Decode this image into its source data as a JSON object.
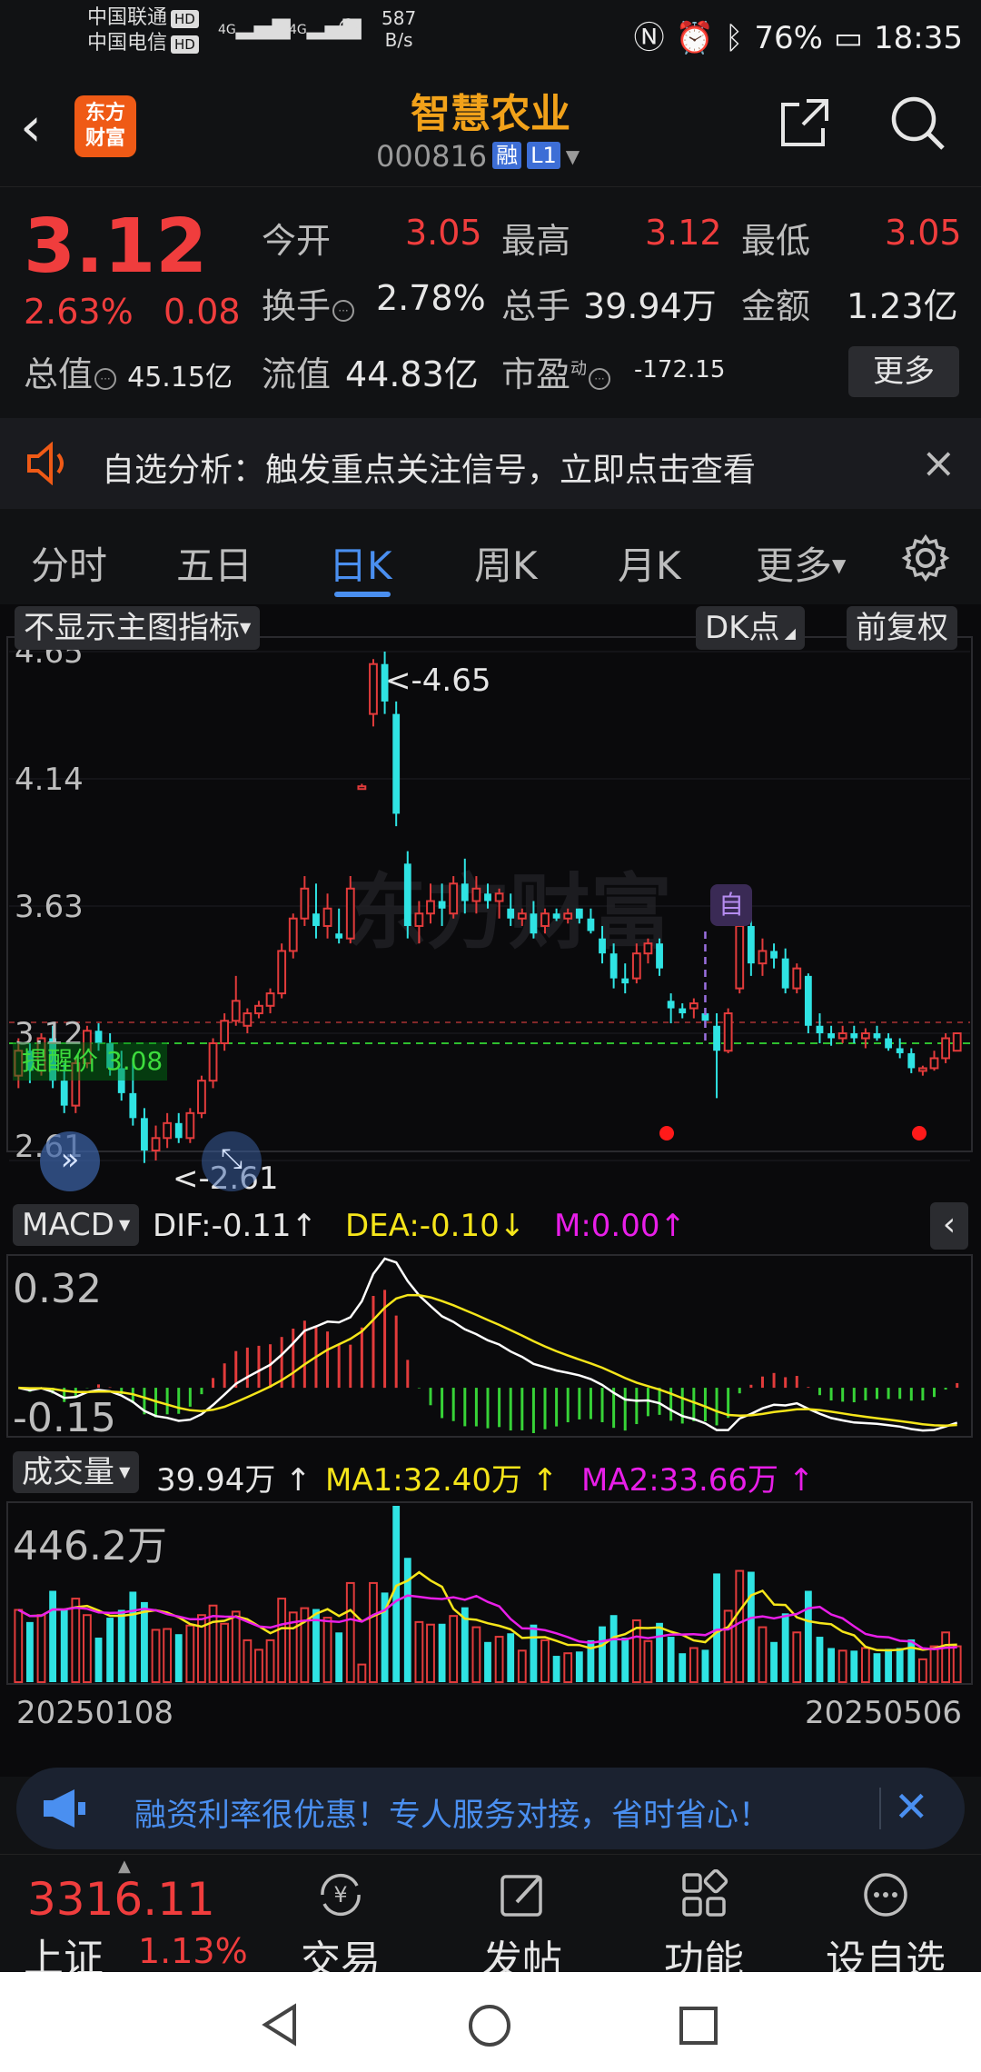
{
  "status_bar": {
    "carrier1": "中国联通",
    "carrier2": "中国电信",
    "hd": "HD",
    "net1": "4G",
    "net2": "4G",
    "speed": "587",
    "speed_unit": "B/s",
    "battery": "76%",
    "time": "18:35"
  },
  "header": {
    "logo_line1": "东方",
    "logo_line2": "财富",
    "title": "智慧农业",
    "code": "000816",
    "badge_rong": "融",
    "badge_level": "L1"
  },
  "quote": {
    "price": "3.12",
    "pct": "2.63%",
    "change": "0.08",
    "total_label": "总值",
    "total_value": "45.15亿",
    "open_label": "今开",
    "open_value": "3.05",
    "high_label": "最高",
    "high_value": "3.12",
    "low_label": "最低",
    "low_value": "3.05",
    "turnover_label": "换手",
    "turnover_value": "2.78%",
    "volume_label": "总手",
    "volume_value": "39.94万",
    "amount_label": "金额",
    "amount_value": "1.23亿",
    "float_label": "流值",
    "float_value": "44.83亿",
    "pe_label": "市盈",
    "pe_sup": "动",
    "pe_value": "-172.15",
    "more": "更多"
  },
  "notice": {
    "text": "自选分析：触发重点关注信号，立即点击查看"
  },
  "tabs": [
    "分时",
    "五日",
    "日K",
    "周K",
    "月K",
    "更多"
  ],
  "active_tab": "日K",
  "chart_controls": {
    "indicator_select": "不显示主图指标",
    "dk_point": "DK点",
    "adjust": "前复权",
    "alert_label": "提醒价 3.08",
    "high_mark": "<-4.65",
    "low_mark": "<-2.61",
    "self_mark": "自",
    "watermark": "东方财富"
  },
  "macd": {
    "label": "MACD",
    "dif": "DIF:-0.11",
    "dea": "DEA:-0.10",
    "m": "M:0.00",
    "top_value": "0.32",
    "bottom_value": "-0.15"
  },
  "volume": {
    "label": "成交量",
    "value": "39.94万",
    "ma1": "MA1:32.40万",
    "ma2": "MA2:33.66万",
    "top_value": "446.2万",
    "start_date": "20250108",
    "end_date": "20250506"
  },
  "chart_data": {
    "type": "candlestick",
    "y_ticks": [
      "4.65",
      "4.14",
      "3.63",
      "3.12",
      "2.61"
    ],
    "y_range": [
      2.61,
      4.65
    ],
    "alert_price": 3.08,
    "x_range": [
      "20250108",
      "20250506"
    ],
    "candles": [
      [
        2.95,
        3.1,
        2.9,
        3.05
      ],
      [
        3.05,
        3.08,
        2.92,
        2.97
      ],
      [
        2.97,
        3.12,
        2.95,
        3.1
      ],
      [
        3.1,
        3.15,
        2.9,
        2.93
      ],
      [
        2.93,
        3.0,
        2.8,
        2.83
      ],
      [
        2.83,
        3.02,
        2.8,
        3.0
      ],
      [
        3.0,
        3.15,
        2.98,
        3.13
      ],
      [
        3.13,
        3.16,
        3.05,
        3.08
      ],
      [
        3.08,
        3.12,
        2.95,
        2.98
      ],
      [
        2.98,
        3.05,
        2.85,
        2.88
      ],
      [
        2.88,
        3.02,
        2.75,
        2.78
      ],
      [
        2.78,
        2.82,
        2.6,
        2.65
      ],
      [
        2.65,
        2.75,
        2.61,
        2.7
      ],
      [
        2.7,
        2.8,
        2.66,
        2.76
      ],
      [
        2.76,
        2.8,
        2.68,
        2.7
      ],
      [
        2.7,
        2.82,
        2.68,
        2.8
      ],
      [
        2.8,
        2.95,
        2.78,
        2.93
      ],
      [
        2.93,
        3.1,
        2.9,
        3.08
      ],
      [
        3.08,
        3.2,
        3.05,
        3.17
      ],
      [
        3.17,
        3.35,
        3.15,
        3.25
      ],
      [
        3.15,
        3.22,
        3.12,
        3.2
      ],
      [
        3.2,
        3.25,
        3.18,
        3.23
      ],
      [
        3.23,
        3.3,
        3.2,
        3.28
      ],
      [
        3.28,
        3.48,
        3.26,
        3.45
      ],
      [
        3.45,
        3.6,
        3.42,
        3.58
      ],
      [
        3.58,
        3.75,
        3.55,
        3.7
      ],
      [
        3.6,
        3.72,
        3.5,
        3.55
      ],
      [
        3.55,
        3.68,
        3.5,
        3.62
      ],
      [
        3.52,
        3.62,
        3.48,
        3.5
      ],
      [
        3.5,
        3.75,
        3.48,
        3.7
      ],
      [
        4.1,
        4.12,
        4.1,
        4.11
      ],
      [
        4.4,
        4.62,
        4.35,
        4.6
      ],
      [
        4.6,
        4.65,
        4.4,
        4.45
      ],
      [
        4.4,
        4.45,
        3.95,
        4.0
      ],
      [
        3.8,
        3.85,
        3.5,
        3.55
      ],
      [
        3.55,
        3.65,
        3.48,
        3.6
      ],
      [
        3.6,
        3.72,
        3.56,
        3.65
      ],
      [
        3.65,
        3.72,
        3.55,
        3.62
      ],
      [
        3.6,
        3.75,
        3.58,
        3.72
      ],
      [
        3.72,
        3.82,
        3.6,
        3.65
      ],
      [
        3.65,
        3.75,
        3.6,
        3.7
      ],
      [
        3.68,
        3.72,
        3.62,
        3.65
      ],
      [
        3.65,
        3.7,
        3.58,
        3.68
      ],
      [
        3.62,
        3.68,
        3.55,
        3.58
      ],
      [
        3.58,
        3.62,
        3.55,
        3.6
      ],
      [
        3.6,
        3.65,
        3.5,
        3.52
      ],
      [
        3.55,
        3.62,
        3.52,
        3.6
      ],
      [
        3.6,
        3.62,
        3.57,
        3.58
      ],
      [
        3.58,
        3.62,
        3.56,
        3.6
      ],
      [
        3.62,
        3.62,
        3.56,
        3.58
      ],
      [
        3.58,
        3.62,
        3.52,
        3.53
      ],
      [
        3.5,
        3.55,
        3.4,
        3.44
      ],
      [
        3.44,
        3.48,
        3.3,
        3.34
      ],
      [
        3.34,
        3.4,
        3.28,
        3.32
      ],
      [
        3.34,
        3.48,
        3.32,
        3.44
      ],
      [
        3.44,
        3.5,
        3.4,
        3.48
      ],
      [
        3.48,
        3.5,
        3.35,
        3.38
      ],
      [
        3.25,
        3.28,
        3.16,
        3.22
      ],
      [
        3.22,
        3.24,
        3.18,
        3.2
      ],
      [
        3.22,
        3.26,
        3.18,
        3.24
      ],
      [
        3.2,
        3.22,
        3.15,
        3.17
      ],
      [
        3.15,
        3.2,
        2.86,
        3.05
      ],
      [
        3.05,
        3.22,
        3.04,
        3.2
      ],
      [
        3.3,
        3.58,
        3.28,
        3.55
      ],
      [
        3.55,
        3.68,
        3.35,
        3.4
      ],
      [
        3.4,
        3.5,
        3.35,
        3.45
      ],
      [
        3.45,
        3.48,
        3.38,
        3.42
      ],
      [
        3.42,
        3.46,
        3.28,
        3.3
      ],
      [
        3.3,
        3.4,
        3.28,
        3.38
      ],
      [
        3.35,
        3.36,
        3.12,
        3.15
      ],
      [
        3.15,
        3.2,
        3.08,
        3.12
      ],
      [
        3.12,
        3.15,
        3.07,
        3.1
      ],
      [
        3.1,
        3.15,
        3.08,
        3.12
      ],
      [
        3.12,
        3.15,
        3.08,
        3.1
      ],
      [
        3.1,
        3.14,
        3.06,
        3.12
      ],
      [
        3.12,
        3.15,
        3.09,
        3.1
      ],
      [
        3.1,
        3.12,
        3.05,
        3.06
      ],
      [
        3.06,
        3.1,
        3.02,
        3.04
      ],
      [
        3.04,
        3.06,
        2.96,
        2.98
      ],
      [
        2.97,
        2.99,
        2.95,
        2.98
      ],
      [
        2.98,
        3.05,
        2.97,
        3.02
      ],
      [
        3.02,
        3.12,
        3.0,
        3.1
      ],
      [
        3.05,
        3.12,
        3.05,
        3.12
      ]
    ]
  }
}
